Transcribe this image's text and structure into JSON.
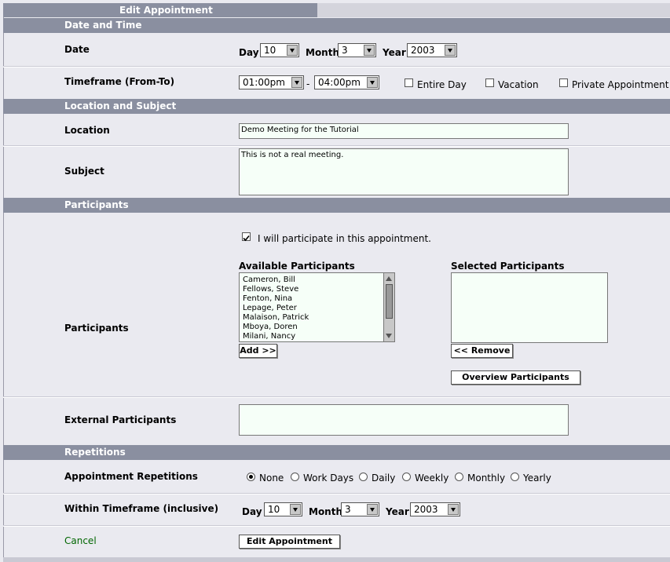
{
  "window": {
    "title": "Edit Appointment"
  },
  "sections": {
    "date_time": "Date and Time",
    "location_subject": "Location and Subject",
    "participants": "Participants",
    "repetitions": "Repetitions"
  },
  "date": {
    "label": "Date",
    "day_label": "Day",
    "day_value": "10",
    "month_label": "Month",
    "month_value": "3",
    "year_label": "Year",
    "year_value": "2003"
  },
  "timeframe": {
    "label": "Timeframe (From-To)",
    "from": "01:00pm",
    "dash": "-",
    "to": "04:00pm",
    "entire_day": "Entire Day",
    "vacation": "Vacation",
    "private": "Private Appointment"
  },
  "location": {
    "label": "Location",
    "value": "Demo Meeting for the Tutorial"
  },
  "subject": {
    "label": "Subject",
    "value": "This is not a real meeting."
  },
  "participants": {
    "label": "Participants",
    "participate_text": "I will participate in this appointment.",
    "available_title": "Available Participants",
    "selected_title": "Selected Participants",
    "available": [
      "Cameron, Bill",
      "Fellows, Steve",
      "Fenton, Nina",
      "Lepage, Peter",
      "Malaison, Patrick",
      "Mboya, Doren",
      "Milani, Nancy"
    ],
    "add_button": "Add >>",
    "remove_button": "<< Remove",
    "overview_button": "Overview Participants"
  },
  "external": {
    "label": "External Participants"
  },
  "repetitions": {
    "label": "Appointment Repetitions",
    "options": [
      "None",
      "Work Days",
      "Daily",
      "Weekly",
      "Monthly",
      "Yearly"
    ],
    "selected": "None"
  },
  "within": {
    "label": "Within Timeframe (inclusive)",
    "day_label": "Day",
    "day_value": "10",
    "month_label": "Month",
    "month_value": "3",
    "year_label": "Year",
    "year_value": "2003"
  },
  "actions": {
    "cancel": "Cancel",
    "submit": "Edit Appointment"
  }
}
